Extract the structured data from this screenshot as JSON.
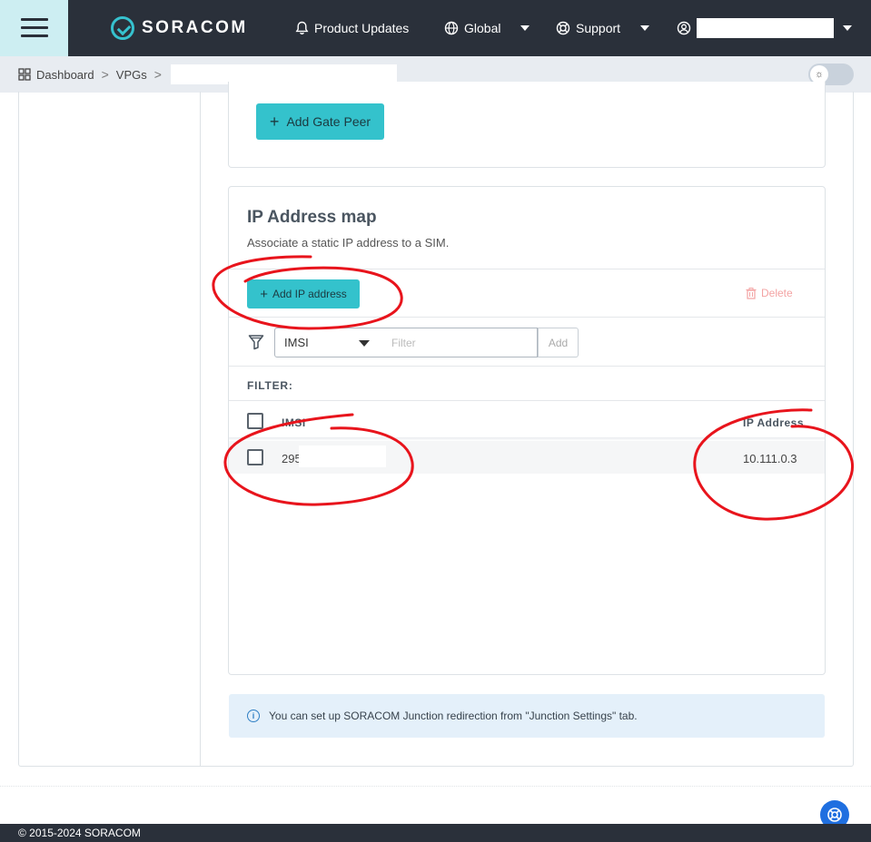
{
  "header": {
    "brand": "SORACOM",
    "nav": {
      "product_updates": "Product Updates",
      "region": "Global",
      "support": "Support"
    }
  },
  "breadcrumb": {
    "items": [
      "Dashboard",
      "VPGs"
    ],
    "separator": ">"
  },
  "gate_peers": {
    "add_button": "Add Gate Peer"
  },
  "ip_map": {
    "title": "IP Address map",
    "description": "Associate a static IP address to a SIM.",
    "add_button": "Add IP address",
    "delete_button": "Delete",
    "filter": {
      "field_selected": "IMSI",
      "placeholder": "Filter",
      "add_label": "Add",
      "label": "FILTER:"
    },
    "columns": [
      "IMSI",
      "IP Address"
    ],
    "rows": [
      {
        "imsi": "295",
        "ip": "10.111.0.3"
      }
    ]
  },
  "info": {
    "text": "You can set up SORACOM Junction redirection from \"Junction Settings\" tab."
  },
  "footer": {
    "copyright": "© 2015-2024 SORACOM"
  },
  "colors": {
    "topbar": "#2a303a",
    "accent": "#34c2cc",
    "menu_bg": "#cdeef2",
    "danger_light": "#f3a3a3",
    "info_bg": "#e4f0fa",
    "annotation": "#e8141c",
    "help_button": "#1f6fe0"
  },
  "icons": {
    "menu": "hamburger-icon",
    "bell": "bell-icon",
    "globe": "globe-icon",
    "support": "lifebuoy-icon",
    "user": "user-circle-icon",
    "dashboard": "grid-icon",
    "filter": "funnel-icon",
    "delete": "trash-icon",
    "info": "info-icon",
    "help": "lifebuoy-icon"
  }
}
